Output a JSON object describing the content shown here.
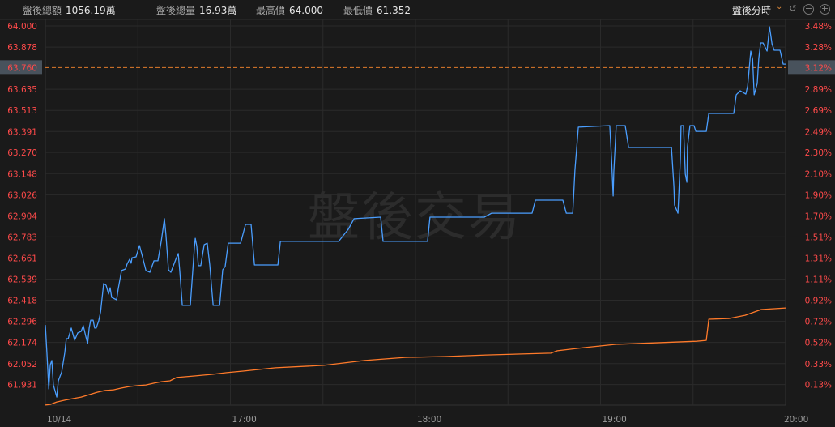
{
  "header": {
    "stats": [
      {
        "label": "盤後總額",
        "value": "1056.19萬"
      },
      {
        "label": "盤後總量",
        "value": "16.93萬"
      },
      {
        "label": "最高價",
        "value": "64.000"
      },
      {
        "label": "最低價",
        "value": "61.352"
      }
    ],
    "mode": "盤後分時",
    "icons": [
      "chevron-down-icon",
      "undo-icon",
      "zoom-out-icon",
      "zoom-in-icon"
    ]
  },
  "chart_data": {
    "type": "line",
    "title": "盤後交易",
    "xlabel": "",
    "ylabel": "",
    "x_unit": "minutes since 16:00",
    "xlim": [
      0,
      240
    ],
    "ylim": [
      61.81,
      64.15
    ],
    "grid": true,
    "current_price": "63.760",
    "left_ticks": [
      "64.000",
      "63.878",
      "63.760",
      "63.635",
      "63.513",
      "63.391",
      "63.270",
      "63.148",
      "63.026",
      "62.904",
      "62.783",
      "62.661",
      "62.539",
      "62.418",
      "62.296",
      "62.174",
      "62.052",
      "61.931"
    ],
    "right_ticks": [
      "3.48%",
      "3.28%",
      "3.12%",
      "2.89%",
      "2.69%",
      "2.49%",
      "2.30%",
      "2.10%",
      "1.90%",
      "1.70%",
      "1.51%",
      "1.31%",
      "1.11%",
      "0.92%",
      "0.72%",
      "0.52%",
      "0.33%",
      "0.13%"
    ],
    "x_ticks": [
      {
        "label": "10/14",
        "x": 0
      },
      {
        "label": "17:00",
        "x": 60
      },
      {
        "label": "18:00",
        "x": 120
      },
      {
        "label": "19:00",
        "x": 180
      },
      {
        "label": "20:00",
        "x": 240
      }
    ],
    "colors": {
      "price": "#4a9eff",
      "average": "#ff7a2a",
      "positive": "#ff4a4a",
      "current_box": "#48525c"
    },
    "series": [
      {
        "name": "price",
        "points": [
          [
            0,
            62.275
          ],
          [
            0.5,
            62.116
          ],
          [
            1.1,
            61.906
          ],
          [
            1.6,
            62.046
          ],
          [
            2.1,
            62.07
          ],
          [
            2.6,
            61.929
          ],
          [
            3.7,
            61.859
          ],
          [
            4.2,
            61.953
          ],
          [
            5.3,
            62.004
          ],
          [
            6.3,
            62.116
          ],
          [
            6.8,
            62.196
          ],
          [
            7.4,
            62.196
          ],
          [
            8.4,
            62.257
          ],
          [
            9.5,
            62.187
          ],
          [
            10.5,
            62.229
          ],
          [
            11.6,
            62.238
          ],
          [
            12.3,
            62.271
          ],
          [
            13.1,
            62.21
          ],
          [
            13.7,
            62.168
          ],
          [
            14.2,
            62.257
          ],
          [
            14.7,
            62.303
          ],
          [
            15.5,
            62.303
          ],
          [
            16.0,
            62.257
          ],
          [
            16.5,
            62.257
          ],
          [
            17.3,
            62.299
          ],
          [
            17.9,
            62.35
          ],
          [
            18.9,
            62.514
          ],
          [
            19.7,
            62.504
          ],
          [
            20.5,
            62.453
          ],
          [
            21.0,
            62.49
          ],
          [
            21.5,
            62.434
          ],
          [
            23.1,
            62.42
          ],
          [
            23.6,
            62.481
          ],
          [
            24.7,
            62.589
          ],
          [
            26.0,
            62.598
          ],
          [
            26.5,
            62.626
          ],
          [
            27.3,
            62.654
          ],
          [
            27.8,
            62.631
          ],
          [
            28.1,
            62.663
          ],
          [
            29.4,
            62.668
          ],
          [
            30.5,
            62.733
          ],
          [
            31.3,
            62.682
          ],
          [
            32.6,
            62.589
          ],
          [
            33.9,
            62.579
          ],
          [
            35.2,
            62.645
          ],
          [
            36.5,
            62.645
          ],
          [
            37.6,
            62.761
          ],
          [
            38.6,
            62.888
          ],
          [
            39.1,
            62.794
          ],
          [
            39.9,
            62.593
          ],
          [
            40.7,
            62.579
          ],
          [
            42.3,
            62.654
          ],
          [
            43.1,
            62.687
          ],
          [
            43.6,
            62.584
          ],
          [
            44.4,
            62.388
          ],
          [
            47.0,
            62.388
          ],
          [
            47.5,
            62.514
          ],
          [
            48.3,
            62.715
          ],
          [
            48.6,
            62.775
          ],
          [
            49.1,
            62.729
          ],
          [
            49.6,
            62.617
          ],
          [
            50.4,
            62.617
          ],
          [
            51.5,
            62.738
          ],
          [
            52.5,
            62.747
          ],
          [
            53.3,
            62.621
          ],
          [
            54.1,
            62.453
          ],
          [
            54.4,
            62.388
          ],
          [
            56.5,
            62.388
          ],
          [
            57.5,
            62.593
          ],
          [
            58.3,
            62.612
          ],
          [
            59.3,
            62.747
          ],
          [
            63.3,
            62.747
          ],
          [
            64.9,
            62.855
          ],
          [
            66.7,
            62.855
          ],
          [
            67.8,
            62.621
          ],
          [
            75.4,
            62.621
          ],
          [
            76.2,
            62.757
          ],
          [
            95.1,
            62.757
          ],
          [
            98.2,
            62.827
          ],
          [
            100.1,
            62.888
          ],
          [
            108.7,
            62.897
          ],
          [
            109.5,
            62.757
          ],
          [
            123.9,
            62.757
          ],
          [
            124.7,
            62.897
          ],
          [
            142.3,
            62.897
          ],
          [
            144.7,
            62.92
          ],
          [
            157.8,
            62.92
          ],
          [
            158.9,
            62.995
          ],
          [
            167.8,
            62.995
          ],
          [
            168.9,
            62.92
          ],
          [
            171.0,
            62.92
          ],
          [
            171.7,
            63.168
          ],
          [
            172.8,
            63.416
          ],
          [
            183.0,
            63.425
          ],
          [
            183.6,
            63.224
          ],
          [
            184.1,
            63.019
          ],
          [
            184.3,
            63.159
          ],
          [
            185.1,
            63.425
          ],
          [
            188.0,
            63.425
          ],
          [
            189.1,
            63.299
          ],
          [
            203.0,
            63.299
          ],
          [
            203.8,
            63.075
          ],
          [
            204.0,
            62.967
          ],
          [
            205.1,
            62.92
          ],
          [
            205.9,
            63.234
          ],
          [
            206.1,
            63.425
          ],
          [
            206.9,
            63.425
          ],
          [
            207.5,
            63.145
          ],
          [
            208.0,
            63.098
          ],
          [
            208.2,
            63.304
          ],
          [
            209.0,
            63.425
          ],
          [
            210.3,
            63.425
          ],
          [
            210.9,
            63.392
          ],
          [
            214.3,
            63.392
          ],
          [
            215.1,
            63.495
          ],
          [
            223.2,
            63.495
          ],
          [
            224.0,
            63.603
          ],
          [
            225.3,
            63.626
          ],
          [
            227.1,
            63.607
          ],
          [
            227.7,
            63.654
          ],
          [
            228.7,
            63.855
          ],
          [
            229.3,
            63.808
          ],
          [
            229.8,
            63.603
          ],
          [
            230.8,
            63.668
          ],
          [
            231.3,
            63.813
          ],
          [
            231.9,
            63.902
          ],
          [
            232.7,
            63.902
          ],
          [
            234.0,
            63.855
          ],
          [
            234.8,
            63.995
          ],
          [
            235.6,
            63.897
          ],
          [
            236.3,
            63.86
          ],
          [
            238.2,
            63.86
          ],
          [
            239.2,
            63.78
          ],
          [
            240.0,
            63.78
          ]
        ]
      },
      {
        "name": "average",
        "points": [
          [
            0,
            61.813
          ],
          [
            1.6,
            61.817
          ],
          [
            3.7,
            61.831
          ],
          [
            6.3,
            61.841
          ],
          [
            8.9,
            61.85
          ],
          [
            11.6,
            61.859
          ],
          [
            14.2,
            61.873
          ],
          [
            16.8,
            61.887
          ],
          [
            19.4,
            61.897
          ],
          [
            22.1,
            61.901
          ],
          [
            24.7,
            61.911
          ],
          [
            27.3,
            61.92
          ],
          [
            29.9,
            61.925
          ],
          [
            32.6,
            61.929
          ],
          [
            35.2,
            61.939
          ],
          [
            37.8,
            61.948
          ],
          [
            40.4,
            61.953
          ],
          [
            42.5,
            61.972
          ],
          [
            48.3,
            61.981
          ],
          [
            54.1,
            61.99
          ],
          [
            58.8,
            62.0
          ],
          [
            64.1,
            62.009
          ],
          [
            74.6,
            62.028
          ],
          [
            90.3,
            62.042
          ],
          [
            103.5,
            62.07
          ],
          [
            116.6,
            62.088
          ],
          [
            129.7,
            62.093
          ],
          [
            142.9,
            62.102
          ],
          [
            163.9,
            62.112
          ],
          [
            166.0,
            62.126
          ],
          [
            174.4,
            62.144
          ],
          [
            184.9,
            62.163
          ],
          [
            211.1,
            62.181
          ],
          [
            214.3,
            62.186
          ],
          [
            215.1,
            62.308
          ],
          [
            221.6,
            62.312
          ],
          [
            226.9,
            62.331
          ],
          [
            232.1,
            62.364
          ],
          [
            240.0,
            62.373
          ]
        ]
      }
    ]
  }
}
